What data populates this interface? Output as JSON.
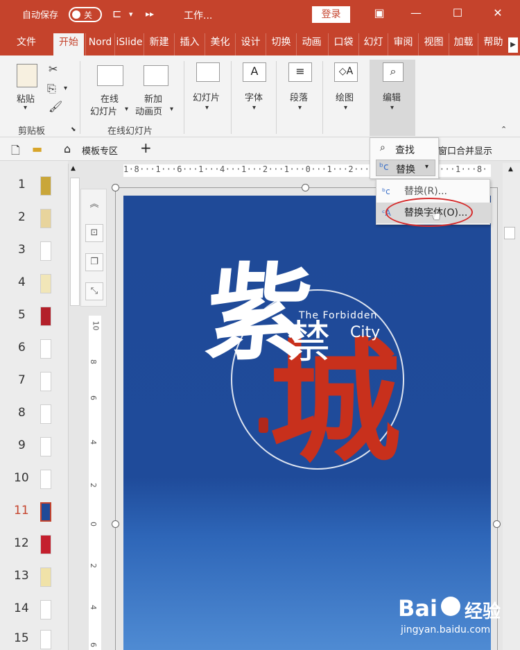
{
  "titlebar": {
    "autosave_label": "自动保存",
    "toggle_state": "关",
    "doc_title": "工作...",
    "login_label": "登录",
    "icons": [
      "format-painter-icon",
      "more-icon",
      "ribbon-display-icon",
      "minimize-icon",
      "maximize-icon",
      "close-icon"
    ]
  },
  "tabs": [
    {
      "label": "文件"
    },
    {
      "label": "开始"
    },
    {
      "label": "Nord"
    },
    {
      "label": "iSlide"
    },
    {
      "label": "新建"
    },
    {
      "label": "插入"
    },
    {
      "label": "美化"
    },
    {
      "label": "设计"
    },
    {
      "label": "切换"
    },
    {
      "label": "动画"
    },
    {
      "label": "口袋"
    },
    {
      "label": "幻灯"
    },
    {
      "label": "审阅"
    },
    {
      "label": "视图"
    },
    {
      "label": "加载"
    },
    {
      "label": "帮助"
    }
  ],
  "active_tab": "开始",
  "ribbon": {
    "paste_label": "粘贴",
    "clipboard_group": "剪贴板",
    "online_slide_label_1": "在线",
    "online_slide_label_2": "幻灯片",
    "new_anim_label_1": "新加",
    "new_anim_label_2": "动画页",
    "online_group": "在线幻灯片",
    "slides_label": "幻灯片",
    "font_label": "字体",
    "paragraph_label": "段落",
    "drawing_label": "绘图",
    "edit_label": "编辑"
  },
  "toolbar2": {
    "template_label": "模板专区",
    "add_label": "+",
    "merge_label": "窗口合并显示"
  },
  "thumbnails": [
    "1",
    "2",
    "3",
    "4",
    "5",
    "6",
    "7",
    "8",
    "9",
    "10",
    "11",
    "12",
    "13",
    "14",
    "15"
  ],
  "selected_slide": "11",
  "ruler": {
    "horizontal": "1·8···1···6···1···4···1···2···1···0···1···2···1···4···1···6···1···8·",
    "vertical": [
      "10",
      "8",
      "6",
      "4",
      "2",
      "0",
      "2",
      "4",
      "6"
    ]
  },
  "slide": {
    "char_1": "紫",
    "char_2": "禁",
    "char_3": "城",
    "en_line_1": "The Forbidden",
    "en_line_2": "City"
  },
  "find_menu": {
    "find_label": "查找",
    "replace_label": "替换"
  },
  "submenu": {
    "replace_item": "替换(R)...",
    "replace_font_item": "替换字体(O)..."
  },
  "watermark": {
    "logo": "Bai",
    "logo2": "经验",
    "url": "jingyan.baidu.com"
  },
  "colors": {
    "accent": "#c5432c",
    "slide_bg": "#1f4a98",
    "title_red": "#c8301c",
    "highlight_oval": "#d52b2b"
  }
}
